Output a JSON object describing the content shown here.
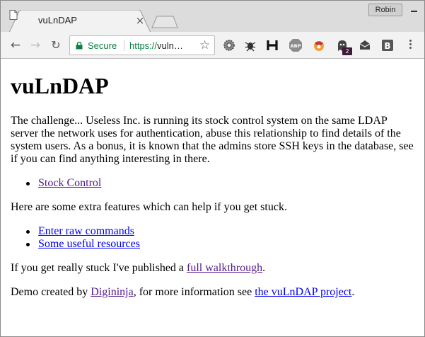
{
  "browser": {
    "tab_title": "vuLnDAP",
    "tab_close_glyph": "×",
    "profile_name": "Robin",
    "secure_label": "Secure",
    "url_scheme": "https://",
    "url_rest": "vuln…",
    "back_glyph": "←",
    "forward_glyph": "→",
    "reload_glyph": "↻",
    "star_glyph": "☆",
    "extension_badge": "2",
    "extension_icons": [
      "gear-extension-icon",
      "bug-extension-icon",
      "h-extension-icon",
      "abp-extension-icon",
      "fox-extension-icon",
      "ghostery-extension-icon",
      "mail-extension-icon",
      "b-extension-icon"
    ],
    "accent_secure": "#0b8043"
  },
  "page": {
    "heading": "vuLnDAP",
    "intro": "The challenge... Useless Inc. is running its stock control system on the same LDAP server the network uses for authentication, abuse this relationship to find details of the system users. As a bonus, it is known that the admins store SSH keys in the database, see if you can find anything interesting in there.",
    "primary_links": [
      {
        "label": "Stock Control"
      }
    ],
    "extra_text": "Here are some extra features which can help if you get stuck.",
    "extra_links": [
      {
        "label": "Enter raw commands"
      },
      {
        "label": "Some useful resources"
      }
    ],
    "stuck_prefix": "If you get really stuck I've published a ",
    "stuck_link": "full walkthrough",
    "stuck_suffix": ".",
    "credit_prefix": "Demo created by ",
    "credit_author": "Digininja",
    "credit_middle": ", for more information see ",
    "credit_project": "the vuLnDAP project",
    "credit_suffix": "."
  }
}
